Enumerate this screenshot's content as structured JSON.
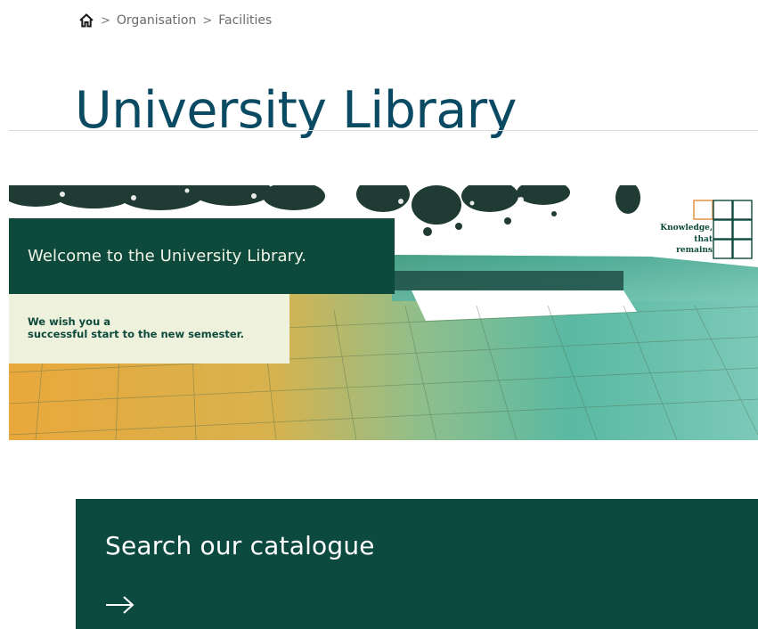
{
  "breadcrumb": {
    "home_icon": "home-icon",
    "separator": ">",
    "items": [
      "Organisation",
      "Facilities"
    ]
  },
  "page": {
    "title": "University Library"
  },
  "banner": {
    "welcome": "Welcome to the University Library.",
    "wish_line1": "We wish you a",
    "wish_line2": "successful start to the new semester.",
    "logo_lines": [
      "Knowledge,",
      "that",
      "remains"
    ],
    "colors": {
      "dark_green": "#0e4a3c",
      "cream": "#eef1dc",
      "orange_accent": "#e08a3a",
      "teal": "#5ab9a3"
    }
  },
  "search": {
    "title": "Search our catalogue",
    "arrow_icon": "arrow-right-icon"
  },
  "colors": {
    "title": "#0b4a63",
    "panel": "#0c4a40"
  }
}
